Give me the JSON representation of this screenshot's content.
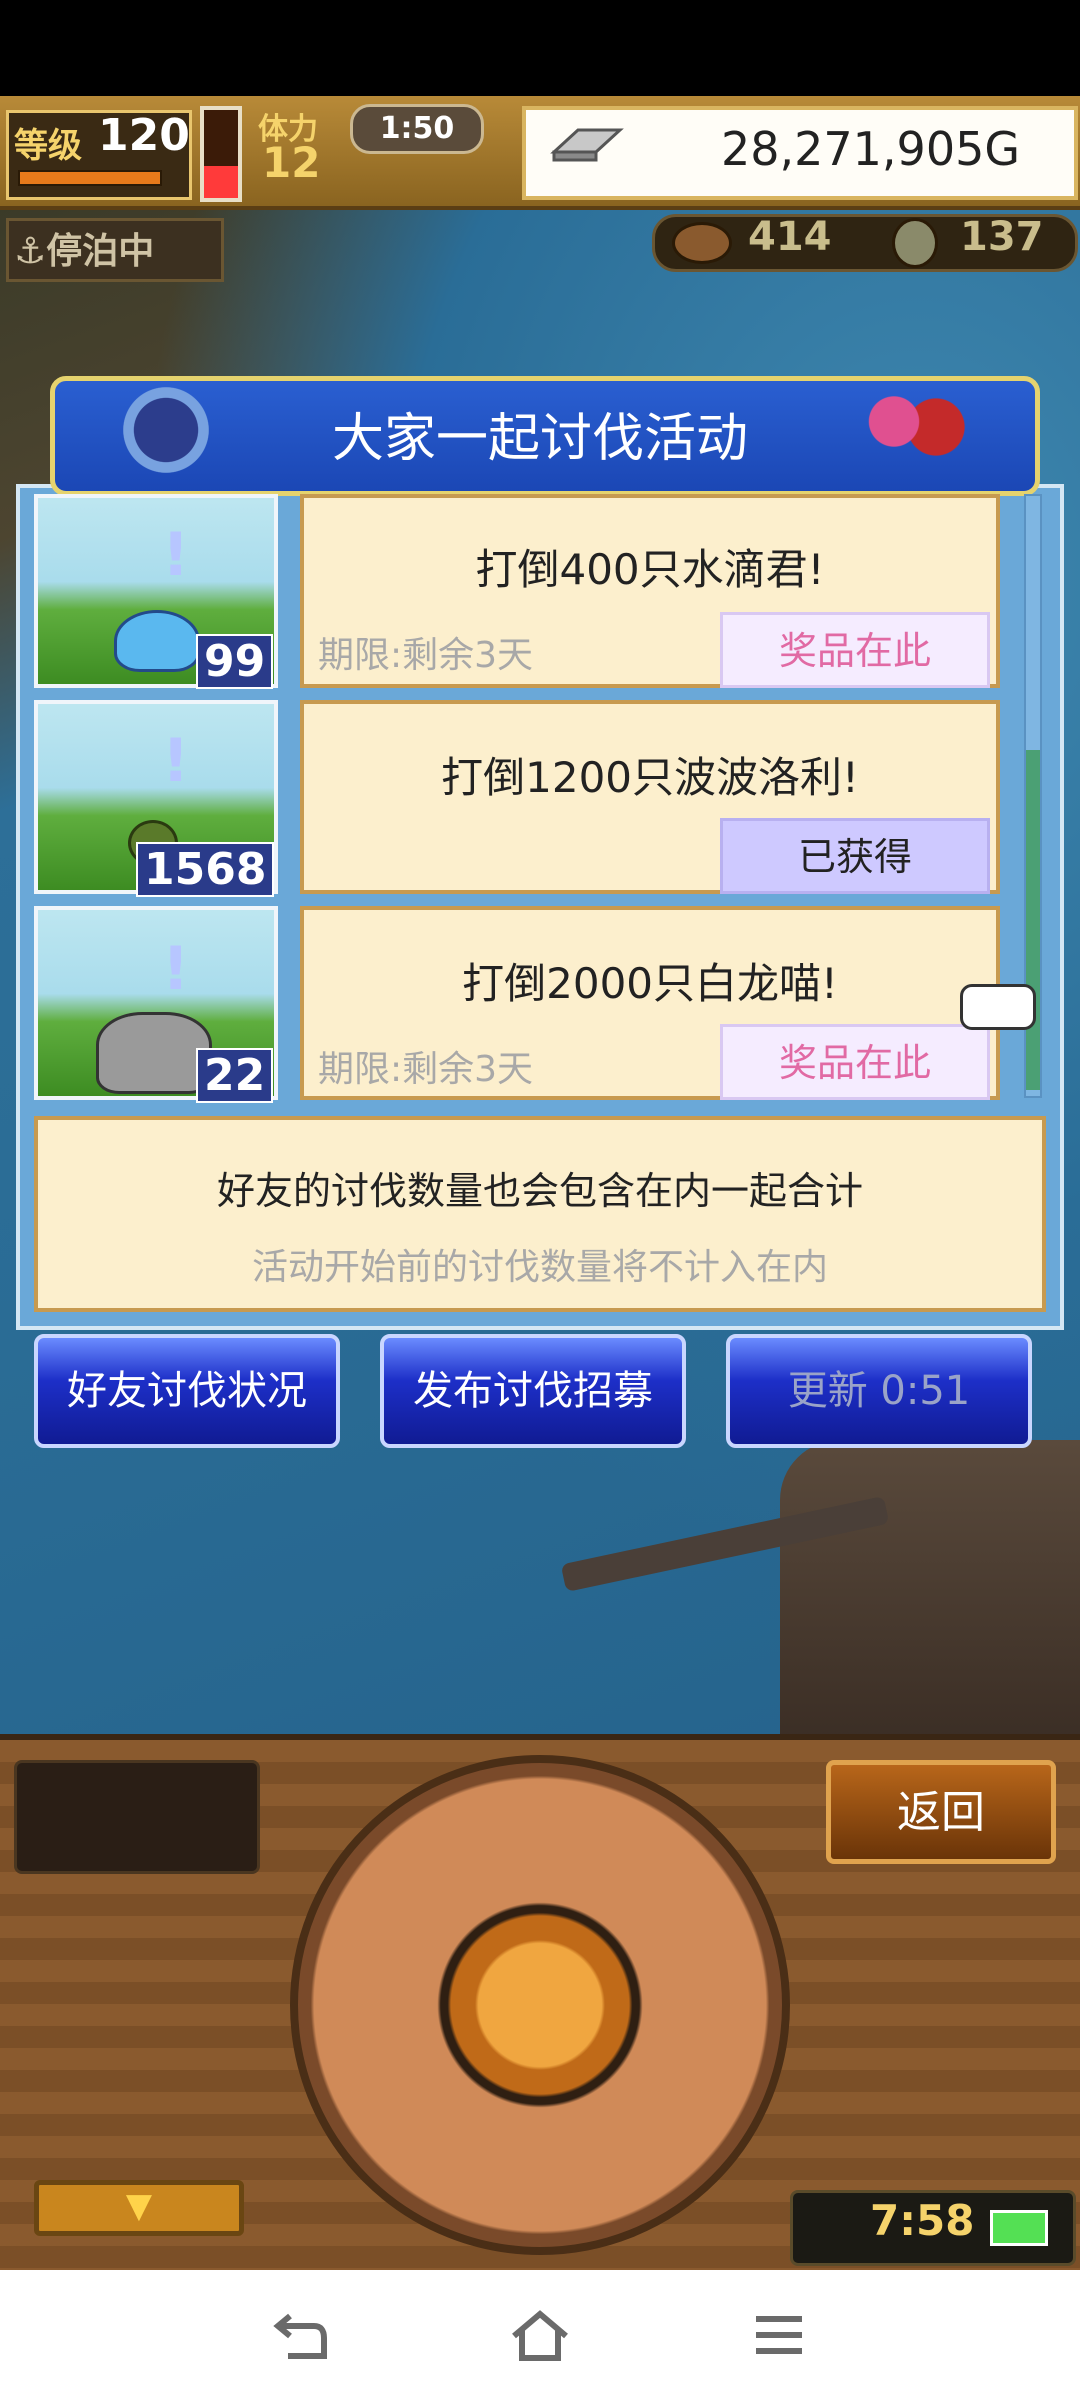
{
  "hud": {
    "level_label": "等级",
    "level_value": "120",
    "stamina_label": "体力",
    "stamina_value": "12",
    "timer": "1:50",
    "gold": "28,271,905G",
    "anchor_status": "停泊中",
    "resource1": "414",
    "resource2": "137"
  },
  "dialog": {
    "title": "大家一起讨伐活动",
    "rows": [
      {
        "title": "打倒400只水滴君!",
        "deadline": "期限:剩余3天",
        "button": "奖品在此",
        "count": "99",
        "monster": "slime-icon"
      },
      {
        "title": "打倒1200只波波洛利!",
        "deadline": "",
        "button": "已获得",
        "count": "1568",
        "monster": "critter-icon"
      },
      {
        "title": "打倒2000只白龙喵!",
        "deadline": "期限:剩余3天",
        "button": "奖品在此",
        "count": "22",
        "monster": "dragon-icon"
      }
    ],
    "info_primary": "好友的讨伐数量也会包含在内一起合计",
    "info_secondary": "活动开始前的讨伐数量将不计入在内",
    "buttons": {
      "friends": "好友讨伐状况",
      "recruit": "发布讨伐招募",
      "update": "更新 0:51"
    }
  },
  "panel": {
    "back": "返回",
    "clock": "7:58"
  },
  "nav": {
    "back_icon": "back-icon",
    "home_icon": "home-icon",
    "menu_icon": "menu-icon"
  },
  "colors": {
    "dialog_blue": "#6aa8d8",
    "card_cream": "#fcefcd",
    "prize_pink": "#e16aa4",
    "obtained_lavender": "#cec9ff",
    "button_blue": "#1d2fc8"
  }
}
